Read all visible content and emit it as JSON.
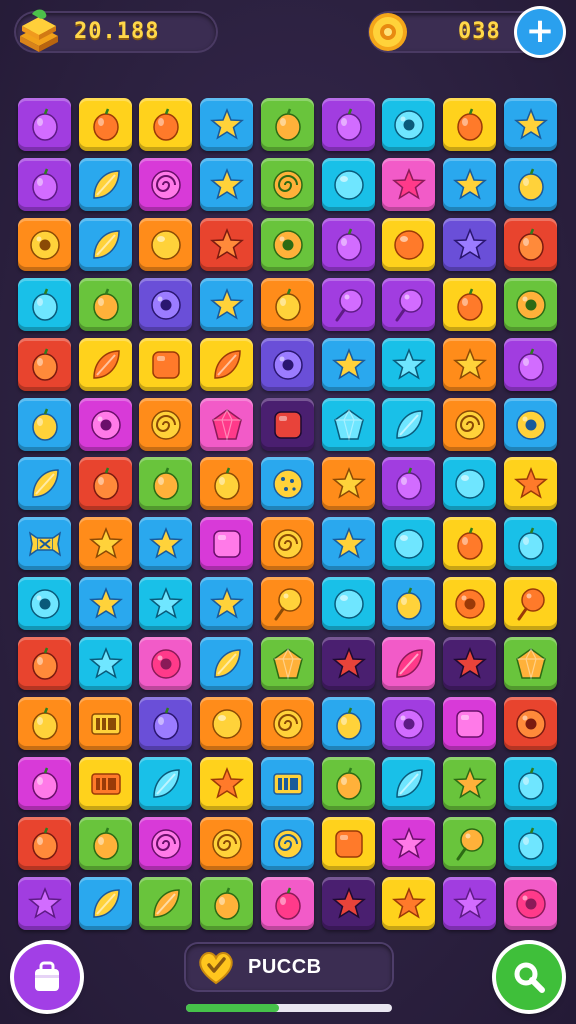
{
  "hud": {
    "score": "20.188",
    "coins": "038",
    "plus_symbol": "+"
  },
  "mode": {
    "label": "PUCCB"
  },
  "progress": {
    "fraction": 0.45
  },
  "colors": {
    "purple": "#a13de0",
    "yellow": "#ffd21c",
    "orange": "#ff8c1a",
    "blue": "#2aa8ee",
    "green": "#69c43c",
    "pink": "#f25bc8",
    "red": "#e8442e",
    "cyan": "#19c0e8",
    "darkpurple": "#4a1f70",
    "indigo": "#6a4fd8",
    "magenta": "#d83ad8",
    "teal": "#17b3b0"
  },
  "board": {
    "rows": [
      [
        [
          "purple",
          "fruit"
        ],
        [
          "yellow",
          "fruit"
        ],
        [
          "yellow",
          "fruit"
        ],
        [
          "blue",
          "star"
        ],
        [
          "green",
          "fruit"
        ],
        [
          "purple",
          "fruit"
        ],
        [
          "cyan",
          "donut"
        ],
        [
          "yellow",
          "fruit"
        ],
        [
          "blue",
          "star"
        ]
      ],
      [
        [
          "purple",
          "fruit"
        ],
        [
          "blue",
          "leaf"
        ],
        [
          "magenta",
          "swirl"
        ],
        [
          "blue",
          "star"
        ],
        [
          "green",
          "swirl"
        ],
        [
          "cyan",
          "bubble"
        ],
        [
          "pink",
          "star"
        ],
        [
          "blue",
          "star"
        ],
        [
          "blue",
          "fruit"
        ]
      ],
      [
        [
          "orange",
          "donut"
        ],
        [
          "blue",
          "leaf"
        ],
        [
          "orange",
          "bubble"
        ],
        [
          "red",
          "star"
        ],
        [
          "green",
          "donut"
        ],
        [
          "purple",
          "fruit"
        ],
        [
          "yellow",
          "bubble"
        ],
        [
          "indigo",
          "star"
        ],
        [
          "red",
          "fruit"
        ]
      ],
      [
        [
          "cyan",
          "fruit"
        ],
        [
          "green",
          "fruit"
        ],
        [
          "indigo",
          "donut"
        ],
        [
          "blue",
          "star"
        ],
        [
          "orange",
          "fruit"
        ],
        [
          "purple",
          "lolly"
        ],
        [
          "purple",
          "lolly"
        ],
        [
          "yellow",
          "fruit"
        ],
        [
          "green",
          "donut"
        ]
      ],
      [
        [
          "red",
          "fruit"
        ],
        [
          "yellow",
          "leaf"
        ],
        [
          "yellow",
          "square"
        ],
        [
          "yellow",
          "leaf"
        ],
        [
          "indigo",
          "donut"
        ],
        [
          "blue",
          "star"
        ],
        [
          "cyan",
          "star"
        ],
        [
          "orange",
          "star"
        ],
        [
          "purple",
          "fruit"
        ]
      ],
      [
        [
          "blue",
          "fruit"
        ],
        [
          "magenta",
          "donut"
        ],
        [
          "orange",
          "swirl"
        ],
        [
          "pink",
          "gem"
        ],
        [
          "darkpurple",
          "square"
        ],
        [
          "cyan",
          "gem"
        ],
        [
          "cyan",
          "leaf"
        ],
        [
          "orange",
          "swirl"
        ],
        [
          "blue",
          "donut"
        ]
      ],
      [
        [
          "blue",
          "leaf"
        ],
        [
          "red",
          "fruit"
        ],
        [
          "green",
          "fruit"
        ],
        [
          "orange",
          "fruit"
        ],
        [
          "blue",
          "cookie"
        ],
        [
          "orange",
          "star"
        ],
        [
          "purple",
          "fruit"
        ],
        [
          "cyan",
          "bubble"
        ],
        [
          "yellow",
          "star"
        ]
      ],
      [
        [
          "blue",
          "candy"
        ],
        [
          "orange",
          "star"
        ],
        [
          "blue",
          "star"
        ],
        [
          "magenta",
          "square"
        ],
        [
          "orange",
          "swirl"
        ],
        [
          "blue",
          "star"
        ],
        [
          "cyan",
          "bubble"
        ],
        [
          "yellow",
          "fruit"
        ],
        [
          "cyan",
          "fruit"
        ]
      ],
      [
        [
          "cyan",
          "donut"
        ],
        [
          "blue",
          "star"
        ],
        [
          "cyan",
          "star"
        ],
        [
          "blue",
          "star"
        ],
        [
          "orange",
          "lolly"
        ],
        [
          "cyan",
          "bubble"
        ],
        [
          "blue",
          "fruit"
        ],
        [
          "yellow",
          "donut"
        ],
        [
          "yellow",
          "lolly"
        ]
      ],
      [
        [
          "red",
          "fruit"
        ],
        [
          "cyan",
          "star"
        ],
        [
          "pink",
          "donut"
        ],
        [
          "blue",
          "leaf"
        ],
        [
          "green",
          "gem"
        ],
        [
          "darkpurple",
          "star"
        ],
        [
          "pink",
          "leaf"
        ],
        [
          "darkpurple",
          "star"
        ],
        [
          "green",
          "gem"
        ]
      ],
      [
        [
          "orange",
          "fruit"
        ],
        [
          "orange",
          "tag"
        ],
        [
          "indigo",
          "fruit"
        ],
        [
          "orange",
          "bubble"
        ],
        [
          "orange",
          "swirl"
        ],
        [
          "blue",
          "fruit"
        ],
        [
          "purple",
          "donut"
        ],
        [
          "magenta",
          "square"
        ],
        [
          "red",
          "donut"
        ]
      ],
      [
        [
          "magenta",
          "fruit"
        ],
        [
          "yellow",
          "tag"
        ],
        [
          "cyan",
          "leaf"
        ],
        [
          "yellow",
          "star"
        ],
        [
          "blue",
          "tag"
        ],
        [
          "green",
          "fruit"
        ],
        [
          "cyan",
          "leaf"
        ],
        [
          "green",
          "star"
        ],
        [
          "cyan",
          "fruit"
        ]
      ],
      [
        [
          "red",
          "fruit"
        ],
        [
          "green",
          "fruit"
        ],
        [
          "magenta",
          "swirl"
        ],
        [
          "orange",
          "swirl"
        ],
        [
          "blue",
          "swirl"
        ],
        [
          "yellow",
          "square"
        ],
        [
          "magenta",
          "star"
        ],
        [
          "green",
          "lolly"
        ],
        [
          "cyan",
          "fruit"
        ]
      ],
      [
        [
          "purple",
          "star"
        ],
        [
          "blue",
          "leaf"
        ],
        [
          "green",
          "leaf"
        ],
        [
          "green",
          "fruit"
        ],
        [
          "pink",
          "fruit"
        ],
        [
          "darkpurple",
          "star"
        ],
        [
          "yellow",
          "star"
        ],
        [
          "purple",
          "star"
        ],
        [
          "pink",
          "donut"
        ]
      ]
    ]
  }
}
